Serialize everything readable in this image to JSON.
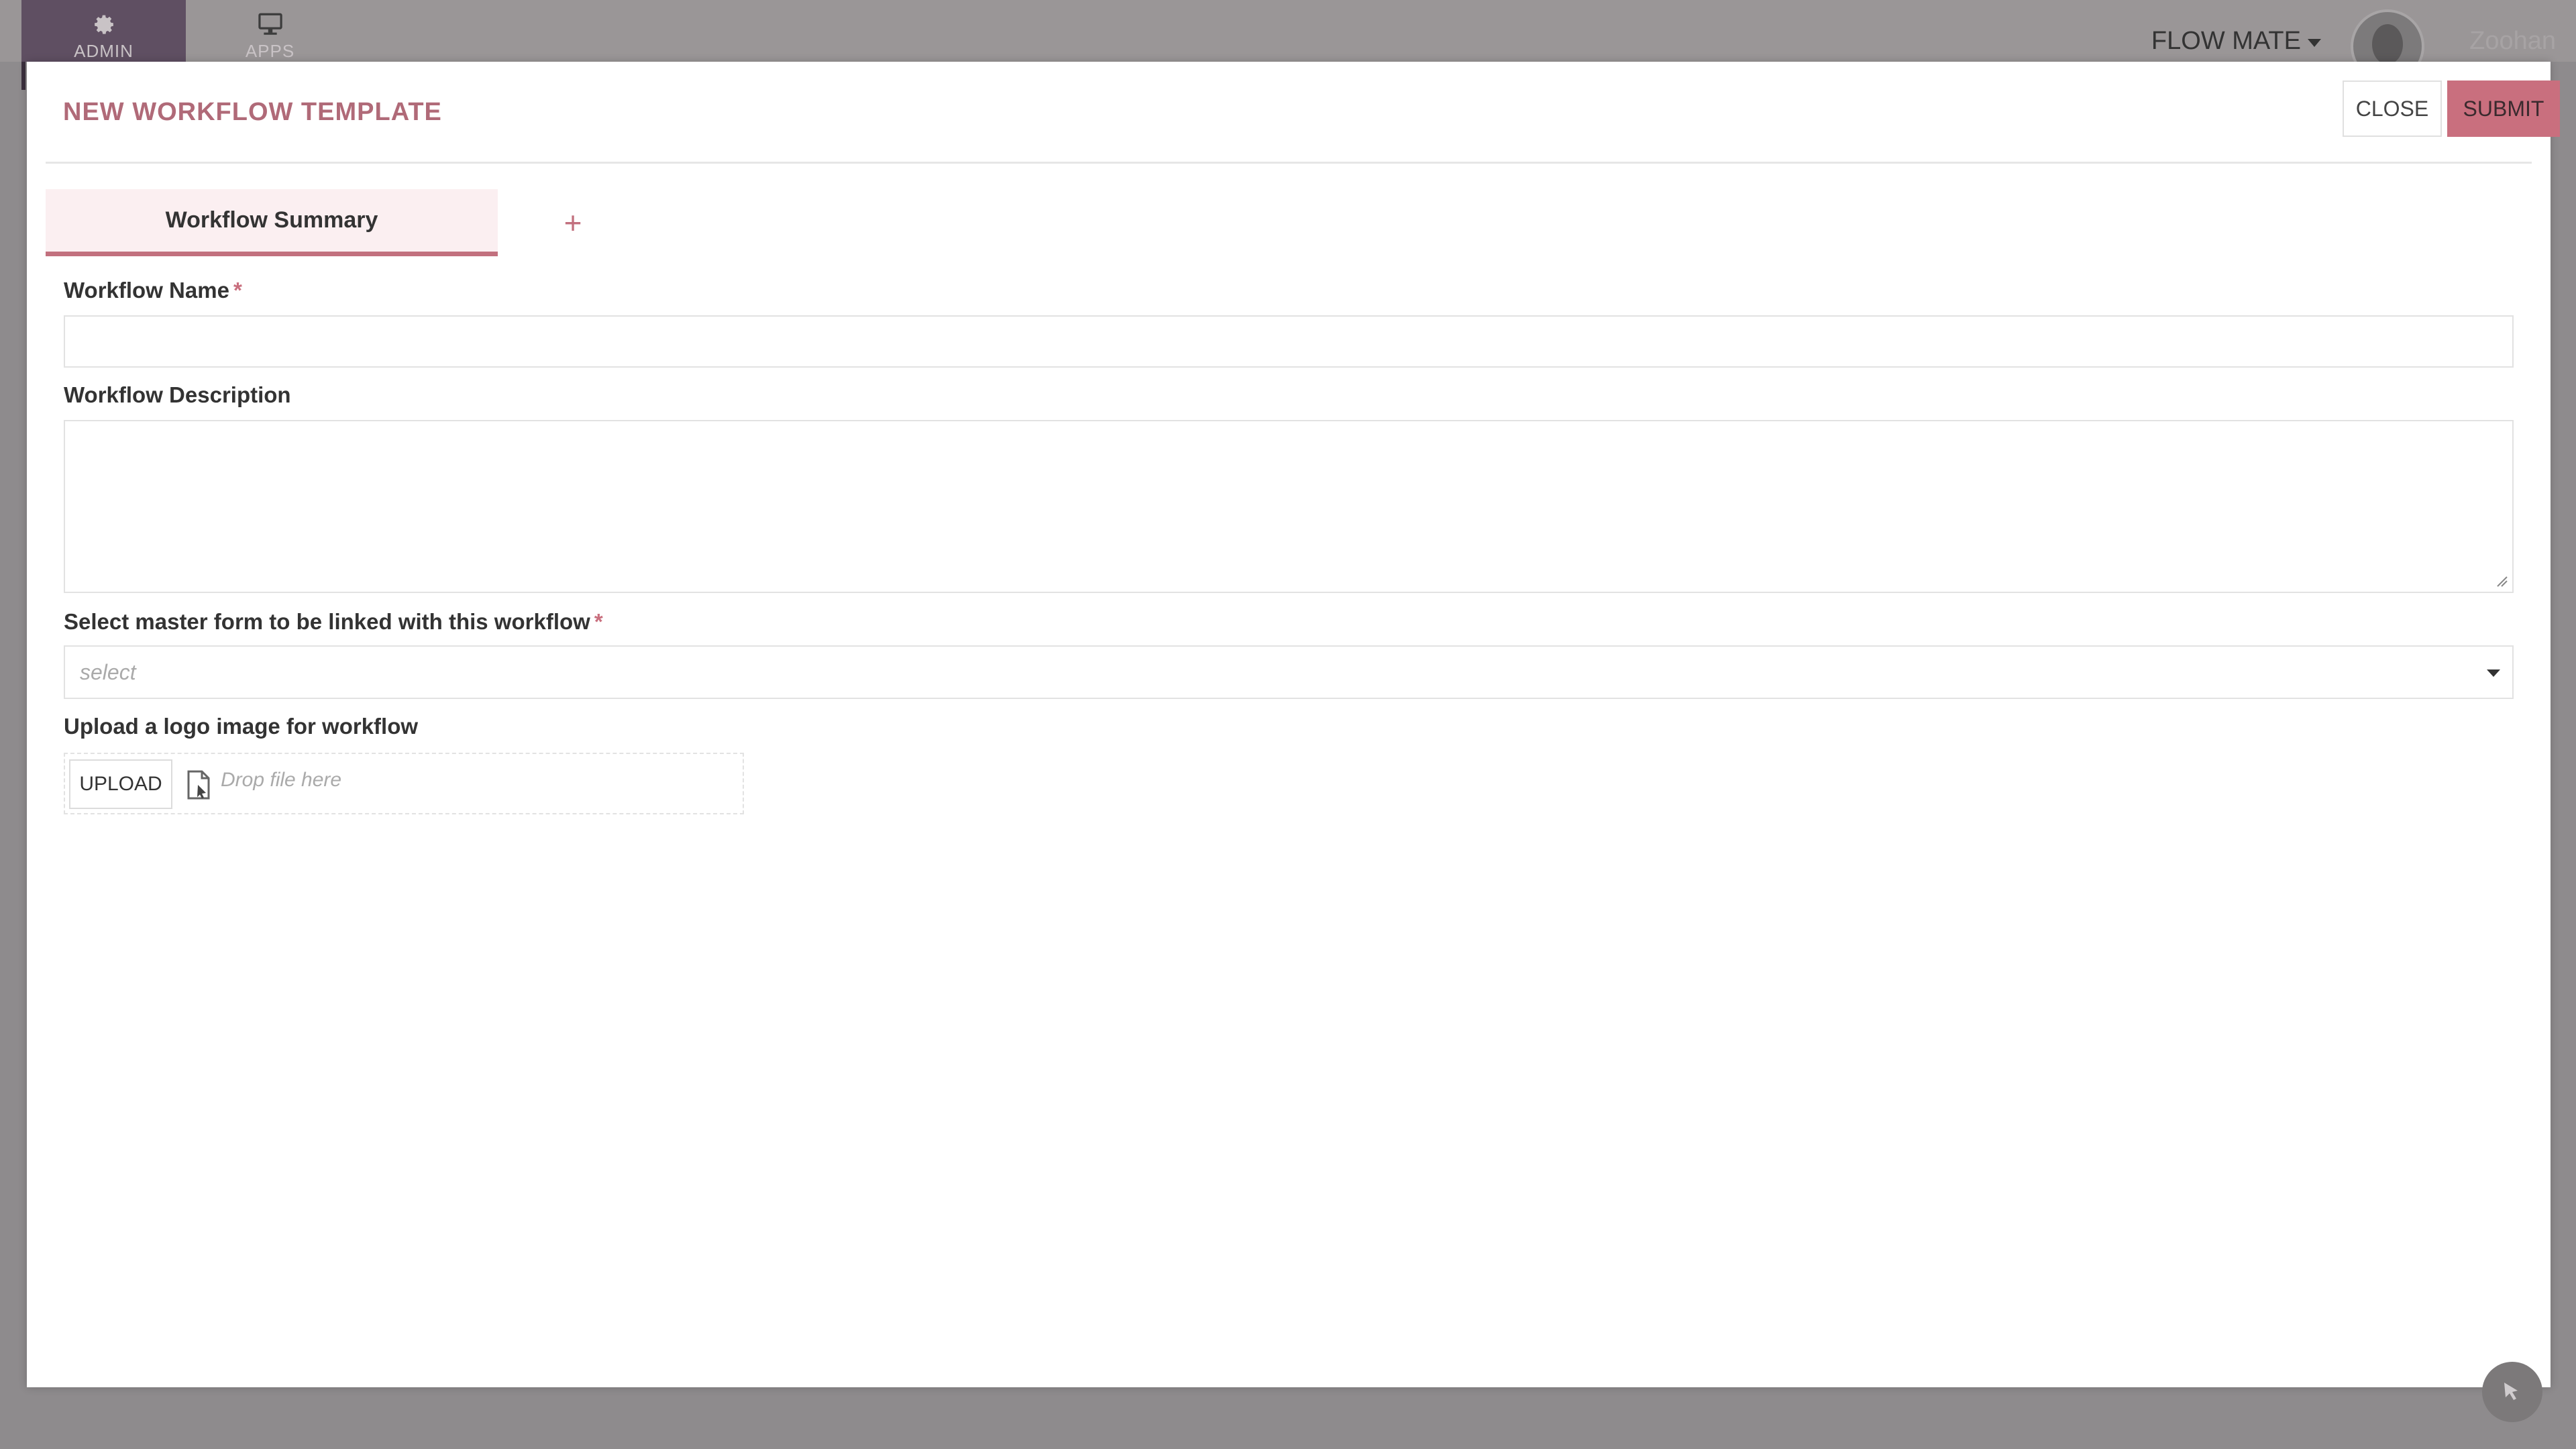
{
  "app": {
    "nav": [
      {
        "label": "ADMIN",
        "icon": "gear-icon"
      },
      {
        "label": "APPS",
        "icon": "monitor-icon"
      }
    ],
    "brand": "FLOW MATE",
    "user_name": "Zoohan"
  },
  "modal": {
    "title": "NEW WORKFLOW TEMPLATE",
    "close_label": "CLOSE",
    "submit_label": "SUBMIT",
    "tabs": [
      {
        "label": "Workflow Summary",
        "active": true
      }
    ],
    "add_tab_label": "+",
    "fields": {
      "workflow_name": {
        "label": "Workflow Name",
        "required_mark": "*",
        "value": ""
      },
      "workflow_description": {
        "label": "Workflow Description",
        "value": ""
      },
      "master_form": {
        "label": "Select master form to be linked with this workflow",
        "required_mark": "*",
        "placeholder": "select"
      },
      "logo_upload": {
        "label": "Upload a logo image for workflow",
        "button_label": "UPLOAD",
        "drop_text": "Drop file here"
      }
    }
  },
  "colors": {
    "accent": "#c96f7e",
    "title": "#b06a78",
    "nav_active": "#5f4f62",
    "overlay": "#8e8b8d"
  }
}
